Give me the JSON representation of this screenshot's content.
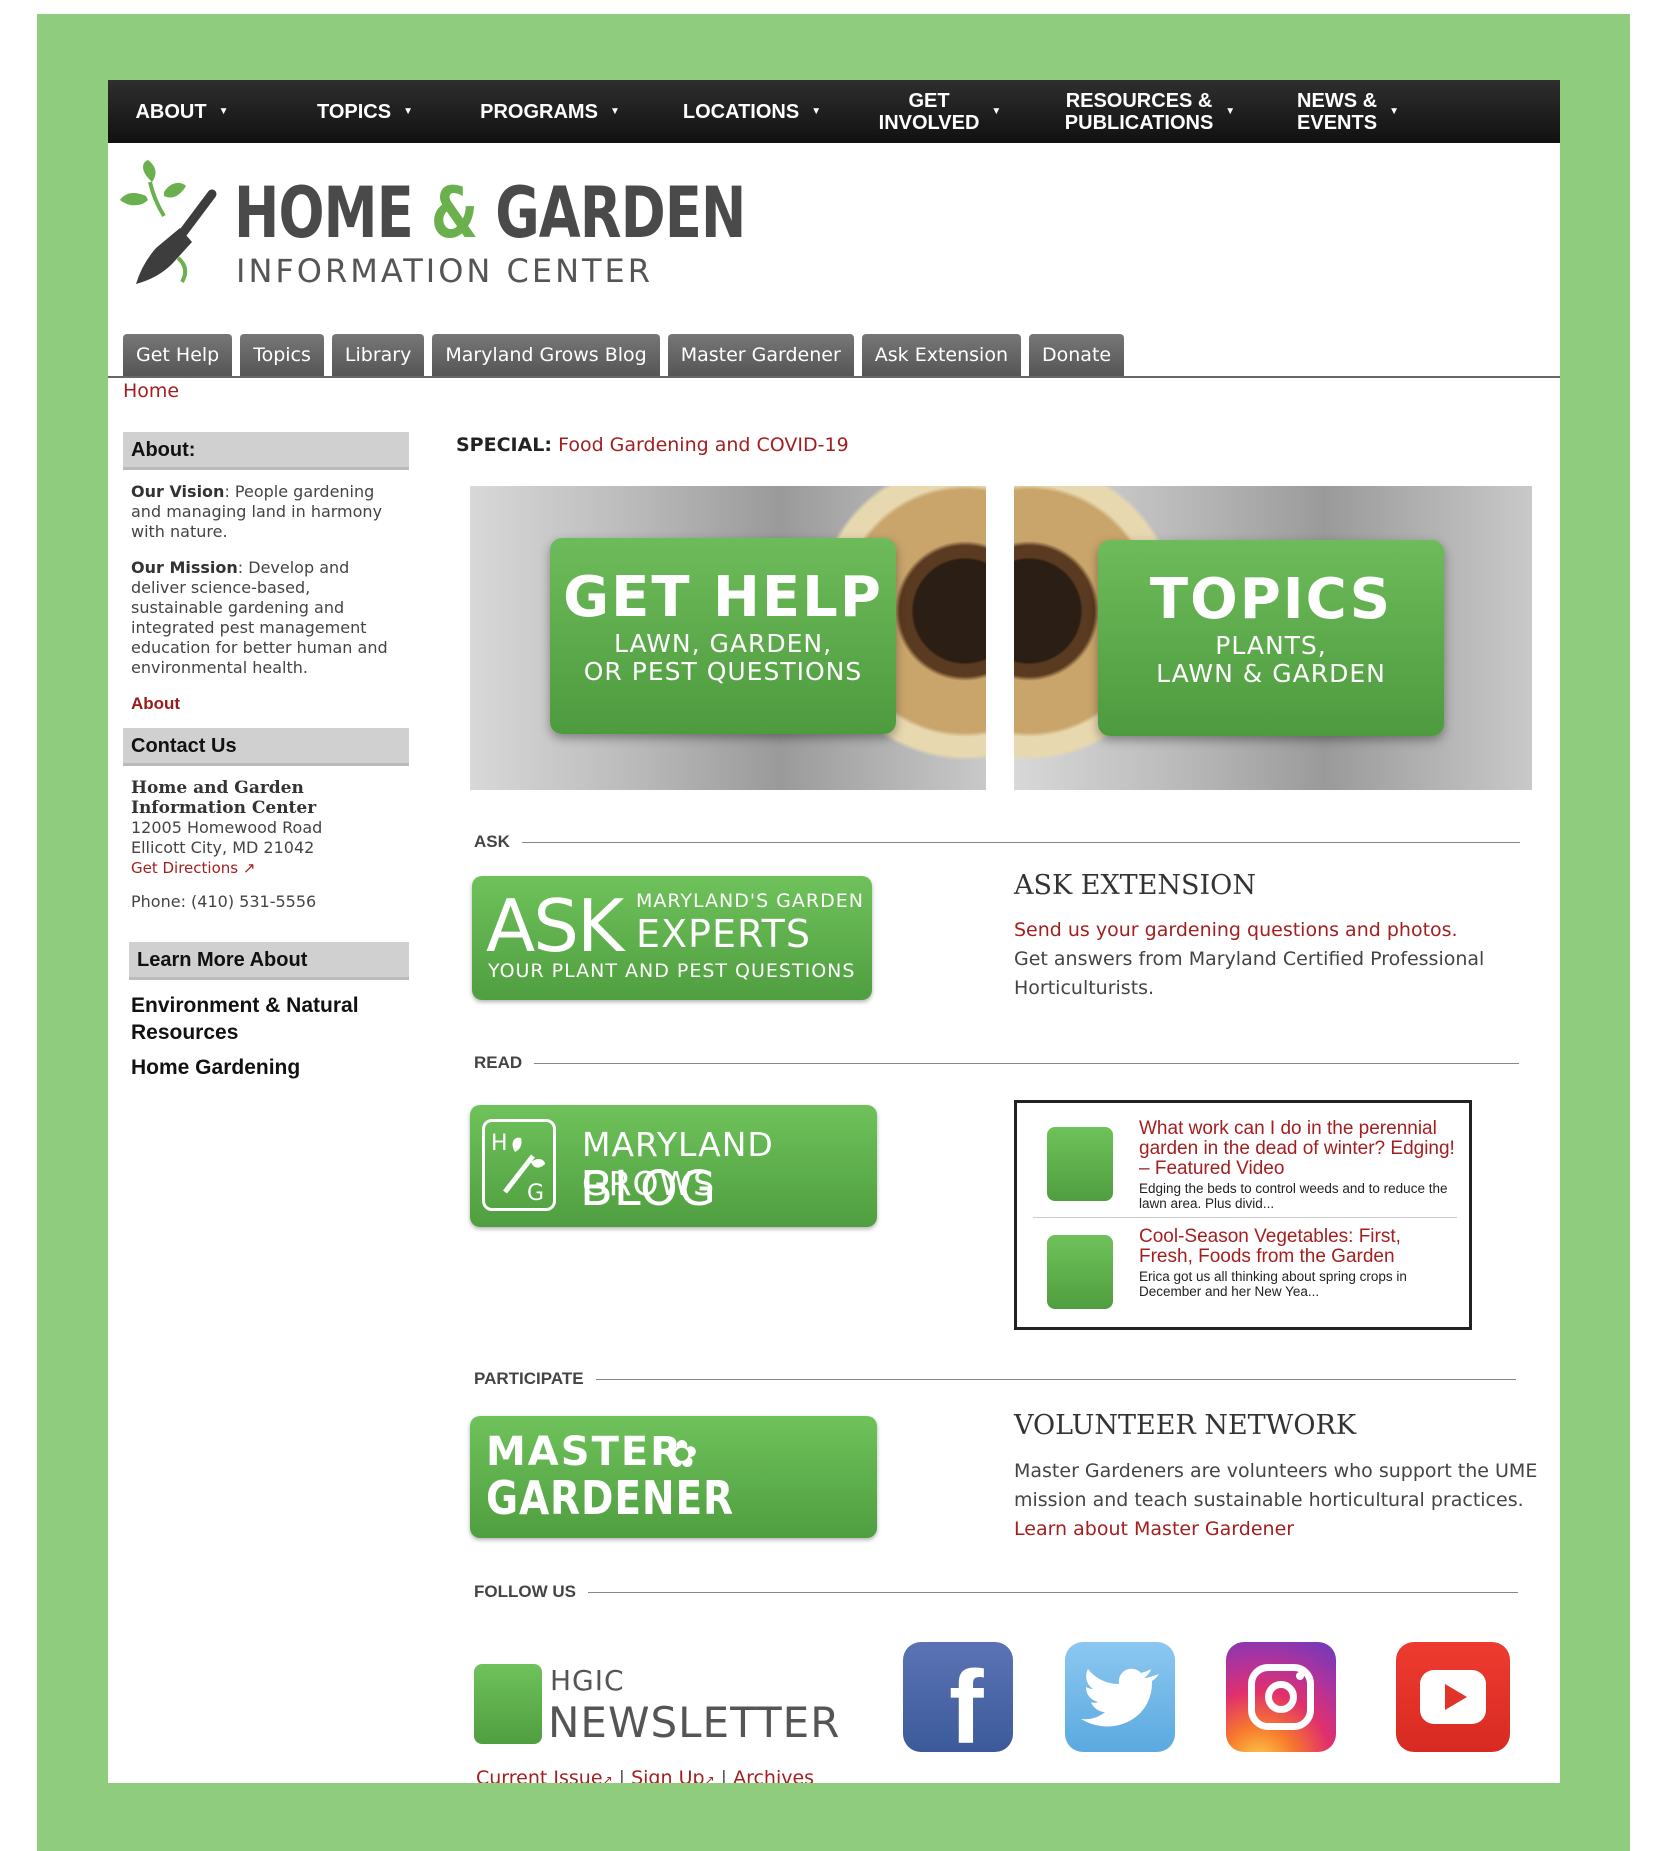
{
  "nav": [
    {
      "label": "ABOUT",
      "key": "about"
    },
    {
      "label": "TOPICS",
      "key": "topics"
    },
    {
      "label": "PROGRAMS",
      "key": "programs"
    },
    {
      "label": "LOCATIONS",
      "key": "locations"
    },
    {
      "label": "GET INVOLVED",
      "line1": "GET",
      "line2": "INVOLVED",
      "key": "get-involved"
    },
    {
      "label": "RESOURCES & PUBLICATIONS",
      "line1": "RESOURCES &",
      "line2": "PUBLICATIONS",
      "key": "resources"
    },
    {
      "label": "NEWS & EVENTS",
      "line1": "NEWS &",
      "line2": "EVENTS",
      "key": "news"
    }
  ],
  "logo": {
    "word1": "HOME",
    "amp": "&",
    "word2": "GARDEN",
    "subtitle": "INFORMATION CENTER"
  },
  "tabs": [
    "Get Help",
    "Topics",
    "Library",
    "Maryland Grows Blog",
    "Master Gardener",
    "Ask Extension",
    "Donate"
  ],
  "breadcrumb": "Home",
  "sidebar": {
    "about_heading": "About:",
    "vision_label": "Our Vision",
    "vision_text": ": People gardening and managing land in harmony with nature.",
    "mission_label": "Our Mission",
    "mission_text": ": Develop and deliver science-based, sustainable gardening and integrated pest management education for better human and environmental health.",
    "about_link": "About",
    "contact_heading": "Contact Us",
    "org_name": "Home and Garden Information Center",
    "address1": "12005 Homewood Road",
    "address2": "Ellicott City, MD 21042",
    "directions": "Get Directions",
    "phone": "Phone: (410) 531-5556",
    "learn_heading": "Learn More About",
    "learn_links": [
      "Environment & Natural Resources",
      "Home Gardening"
    ]
  },
  "special": {
    "label": "SPECIAL:",
    "link": "Food Gardening and COVID-19"
  },
  "banners": {
    "get_help": {
      "title": "GET HELP",
      "line1": "LAWN, GARDEN,",
      "line2": "OR PEST QUESTIONS"
    },
    "topics": {
      "title": "TOPICS",
      "line1": "PLANTS,",
      "line2": "LAWN & GARDEN"
    }
  },
  "sections": {
    "ask": "ASK",
    "read": "READ",
    "participate": "PARTICIPATE",
    "follow": "FOLLOW US"
  },
  "ask_button": {
    "big": "ASK",
    "top": "MARYLAND'S GARDEN",
    "mid": "EXPERTS",
    "bottom": "YOUR PLANT AND PEST QUESTIONS"
  },
  "ask_extension": {
    "heading": "ASK EXTENSION",
    "link": "Send us your gardening questions and photos.",
    "text": "Get answers from Maryland Certified Professional Horticulturists."
  },
  "blog_button": {
    "line1": "MARYLAND GROWS",
    "line2": "BLOG"
  },
  "feed": [
    {
      "title": "What work can I do in the perennial garden in the dead of winter? Edging! – Featured Video",
      "desc": "Edging the beds to control weeds and to reduce the lawn area. Plus divid..."
    },
    {
      "title": "Cool-Season Vegetables: First, Fresh, Foods from the Garden",
      "desc": "Erica got us all thinking about spring crops in December and her New Yea..."
    }
  ],
  "mg_button": {
    "line1": "MASTER",
    "line2": "GARDENER"
  },
  "volunteer": {
    "heading": "VOLUNTEER NETWORK",
    "text": "Master Gardeners are volunteers who support the UME mission and teach sustainable horticultural practices. ",
    "link": "Learn about Master Gardener"
  },
  "newsletter": {
    "small": "HGIC",
    "big": "NEWSLETTER"
  },
  "footer_links": {
    "current": "Current Issue",
    "sep1": " | ",
    "signup": "Sign Up",
    "sep2": " | ",
    "archives": "Archives"
  },
  "social": [
    "facebook",
    "twitter",
    "instagram",
    "youtube"
  ],
  "colors": {
    "frame": "#8fcc7e",
    "link_red": "#a31f1f",
    "green": "#5cae4a",
    "nav_dark": "#1a1a1a"
  }
}
